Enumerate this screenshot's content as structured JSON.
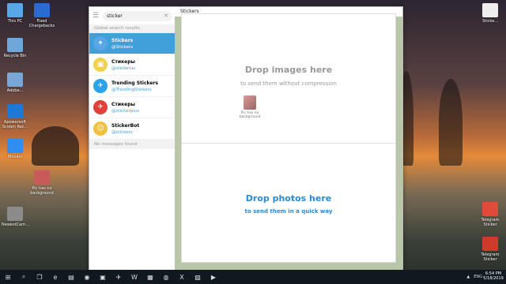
{
  "desktop": {
    "icons_left": [
      {
        "label": "This PC",
        "color": "#5aa7e8"
      },
      {
        "label": "Fixed Chargebacks",
        "color": "#2b6ad1"
      },
      {
        "label": "Recycle Bin",
        "color": "#6fa8d8"
      },
      {
        "label": "Adobe...",
        "color": "#7aa6d6"
      },
      {
        "label": "Apowersoft Screen Rec...",
        "color": "#1f78d6"
      },
      {
        "label": "Movavi",
        "color": "#2f8ef0"
      },
      {
        "label": "Pic has no background",
        "color": "#c85a5a"
      },
      {
        "label": "NewestCam...",
        "color": "#8b8b8b"
      }
    ],
    "icons_right": [
      {
        "label": "Sticke...",
        "color": "#eeeeee"
      },
      {
        "label": "Telegram Sticker",
        "color": "#e04a3a"
      },
      {
        "label": "Telegram Sticker",
        "color": "#d03a2a"
      }
    ]
  },
  "telegram": {
    "search": {
      "value": "sticker"
    },
    "section_label": "Global search results",
    "results": [
      {
        "name": "Stickers",
        "username": "@Stickers",
        "active": true,
        "avatar_color": "#5aa5e6",
        "avatar_glyph": "✦"
      },
      {
        "name": "Стикеры",
        "username": "@stickerus",
        "active": false,
        "avatar_color": "#f1d24a",
        "avatar_glyph": "▣"
      },
      {
        "name": "Trending Stickers",
        "username": "@TrendingStickers",
        "active": false,
        "avatar_color": "#2aa3e8",
        "avatar_glyph": "✈"
      },
      {
        "name": "Стикеры",
        "username": "@stickerplus",
        "active": false,
        "avatar_color": "#e0403a",
        "avatar_glyph": "✈"
      },
      {
        "name": "StickerBot",
        "username": "@stickers",
        "active": false,
        "avatar_color": "#f0c040",
        "avatar_glyph": "☺"
      }
    ],
    "no_messages": "No messages found",
    "chat_title": "Stickers",
    "drop_images": {
      "title": "Drop images here",
      "subtitle": "to send them without compression"
    },
    "drop_photos": {
      "title": "Drop photos here",
      "subtitle": "to send them in a quick way"
    },
    "drag_file_label": "Pic has no background"
  },
  "taskbar": {
    "icons": [
      "start-icon",
      "search-icon",
      "task-view-icon",
      "edge-icon",
      "explorer-icon",
      "chrome-icon",
      "store-icon",
      "telegram-icon",
      "word-icon",
      "calculator-icon",
      "line-icon",
      "excel-icon",
      "photos-icon",
      "media-icon"
    ],
    "time": "6:54 PM",
    "date": "5/18/2019",
    "lang": "ENG"
  }
}
